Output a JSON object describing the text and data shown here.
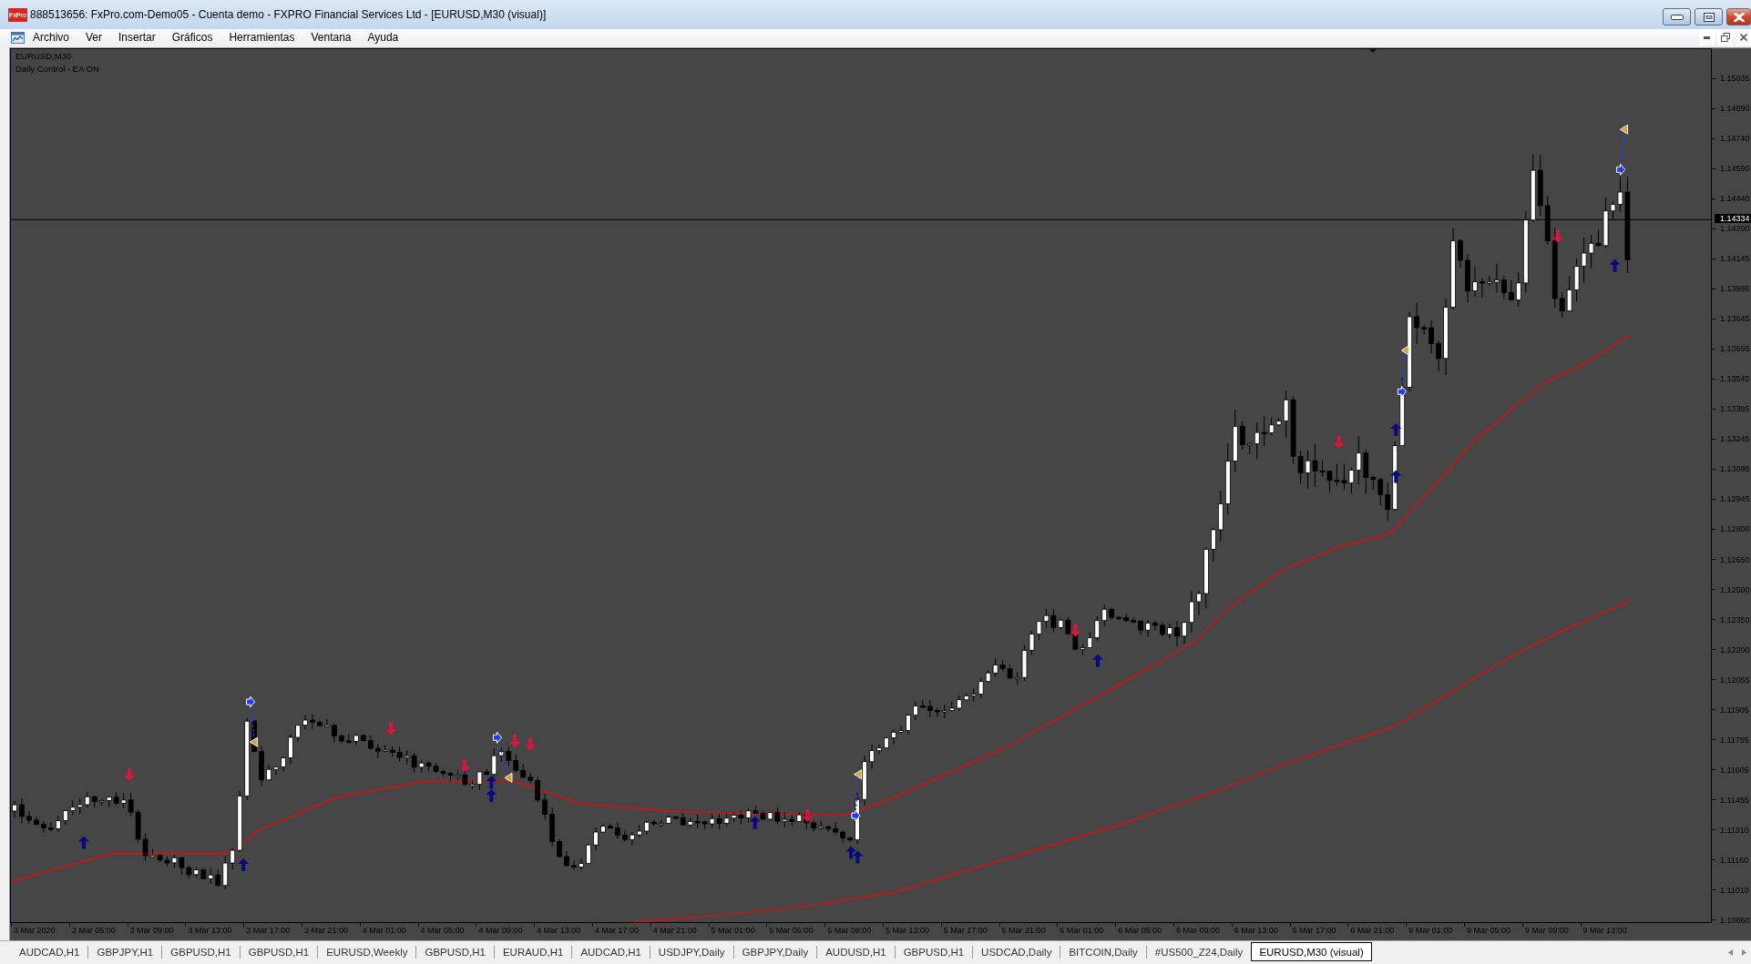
{
  "window": {
    "logo": "FxPro",
    "title": "888513656: FxPro.com-Demo05 - Cuenta demo - FXPRO Financial Services Ltd - [EURUSD,M30 (visual)]"
  },
  "menu": {
    "items": [
      "Archivo",
      "Ver",
      "Insertar",
      "Gráficos",
      "Herramientas",
      "Ventana",
      "Ayuda"
    ]
  },
  "chart": {
    "symbol": "EURUSD,M30",
    "expert_status": "Daily Control - EA ON",
    "current_price": "1.14334",
    "price_ticks": [
      "1.15035",
      "1.14890",
      "1.14740",
      "1.14590",
      "1.14440",
      "1.14290",
      "1.14145",
      "1.13995",
      "1.13845",
      "1.13695",
      "1.13545",
      "1.13395",
      "1.13245",
      "1.13095",
      "1.12945",
      "1.12800",
      "1.12650",
      "1.12500",
      "1.12350",
      "1.12200",
      "1.12055",
      "1.11905",
      "1.11755",
      "1.11605",
      "1.11455",
      "1.11310",
      "1.11160",
      "1.11010",
      "1.10860"
    ],
    "time_ticks": [
      "3 Mar 2020",
      "3 Mar 05:00",
      "3 Mar 09:00",
      "3 Mar 13:00",
      "3 Mar 17:00",
      "3 Mar 21:00",
      "4 Mar 01:00",
      "4 Mar 05:00",
      "4 Mar 09:00",
      "4 Mar 13:00",
      "4 Mar 17:00",
      "4 Mar 21:00",
      "5 Mar 01:00",
      "5 Mar 05:00",
      "5 Mar 09:00",
      "5 Mar 13:00",
      "5 Mar 17:00",
      "5 Mar 21:00",
      "6 Mar 01:00",
      "6 Mar 05:00",
      "6 Mar 09:00",
      "6 Mar 13:00",
      "6 Mar 17:00",
      "6 Mar 21:00",
      "9 Mar 01:00",
      "9 Mar 05:00",
      "9 Mar 09:00",
      "9 Mar 13:00"
    ]
  },
  "tabs": [
    {
      "label": "AUDCAD,H1",
      "selected": false
    },
    {
      "label": "GBPJPY,H1",
      "selected": false
    },
    {
      "label": "GBPUSD,H1",
      "selected": false
    },
    {
      "label": "GBPUSD,H1",
      "selected": false
    },
    {
      "label": "EURUSD,Weekly",
      "selected": false
    },
    {
      "label": "GBPUSD,H1",
      "selected": false
    },
    {
      "label": "EURAUD,H1",
      "selected": false
    },
    {
      "label": "AUDCAD,H1",
      "selected": false
    },
    {
      "label": "USDJPY,Daily",
      "selected": false
    },
    {
      "label": "GBPJPY,Daily",
      "selected": false
    },
    {
      "label": "AUDUSD,H1",
      "selected": false
    },
    {
      "label": "GBPUSD,H1",
      "selected": false
    },
    {
      "label": "USDCAD,Daily",
      "selected": false
    },
    {
      "label": "BITCOIN,Daily",
      "selected": false
    },
    {
      "label": "#US500_Z24,Daily",
      "selected": false
    },
    {
      "label": "EURUSD,M30 (visual)",
      "selected": true
    }
  ]
}
